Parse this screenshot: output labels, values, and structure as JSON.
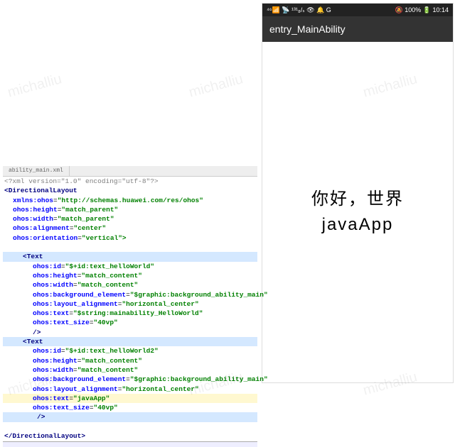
{
  "watermarks": [
    "michalliu",
    "michalliu",
    "michalliu",
    "michalliu",
    "michalliu",
    "michalliu"
  ],
  "phone": {
    "status_left": "⁴⁶📶 📡 ¹³¹₈/ₛ 👁 🔔 G",
    "status_right": "🔕 100% 🔋 10:14",
    "appbar": "entry_MainAbility",
    "line1": "你好，世界",
    "line2": "javaApp"
  },
  "editor": {
    "file": "ability_main.xml",
    "xml_decl": "<?xml version=\"1.0\" encoding=\"utf-8\"?>",
    "root_open": "DirectionalLayout",
    "root_close": "</DirectionalLayout>",
    "root_attrs": [
      {
        "n": "xmlns:ohos",
        "v": "\"http://schemas.huawei.com/res/ohos\""
      },
      {
        "n": "ohos:height",
        "v": "\"match_parent\""
      },
      {
        "n": "ohos:width",
        "v": "\"match_parent\""
      },
      {
        "n": "ohos:alignment",
        "v": "\"center\""
      },
      {
        "n": "ohos:orientation",
        "v": "\"vertical\">"
      }
    ],
    "text_tag": "Text",
    "text1": [
      {
        "n": "ohos:id",
        "v": "\"$+id:text_helloWorld\""
      },
      {
        "n": "ohos:height",
        "v": "\"match_content\""
      },
      {
        "n": "ohos:width",
        "v": "\"match_content\""
      },
      {
        "n": "ohos:background_element",
        "v": "\"$graphic:background_ability_main\""
      },
      {
        "n": "ohos:layout_alignment",
        "v": "\"horizontal_center\""
      },
      {
        "n": "ohos:text",
        "v": "\"$string:mainability_HelloWorld\""
      },
      {
        "n": "ohos:text_size",
        "v": "\"40vp\""
      }
    ],
    "self_close": "/>",
    "text2": [
      {
        "n": "ohos:id",
        "v": "\"$+id:text_helloWorld2\""
      },
      {
        "n": "ohos:height",
        "v": "\"match_content\""
      },
      {
        "n": "ohos:width",
        "v": "\"match_content\""
      },
      {
        "n": "ohos:background_element",
        "v": "\"$graphic:background_ability_main\""
      },
      {
        "n": "ohos:layout_alignment",
        "v": "\"horizontal_center\""
      },
      {
        "n": "ohos:text",
        "v": "\"javaApp\""
      },
      {
        "n": "ohos:text_size",
        "v": "\"40vp\""
      }
    ],
    "cursor": "/>"
  }
}
